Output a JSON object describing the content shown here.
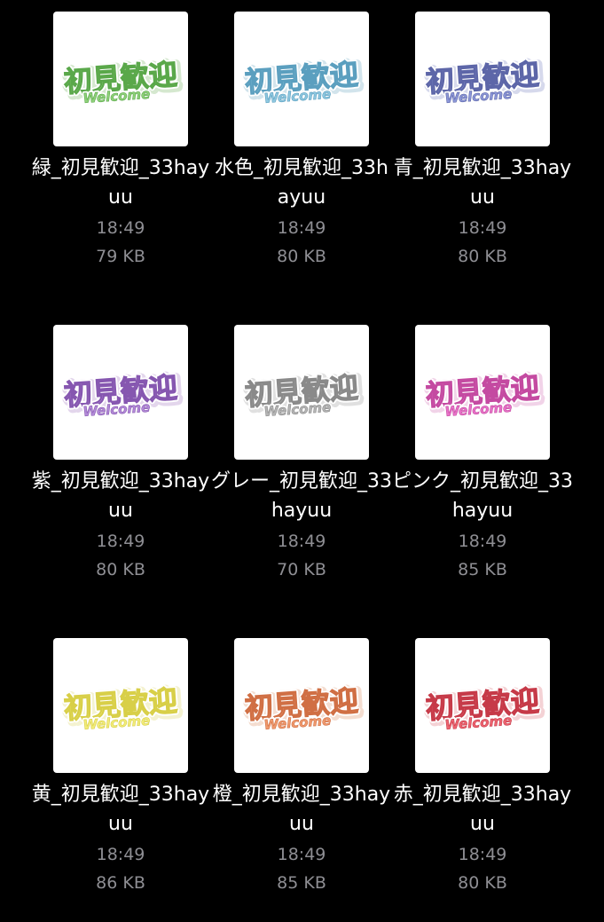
{
  "files": [
    {
      "name": "緑_初見歓迎_33hayuu",
      "time": "18:49",
      "size": "79 KB",
      "logo": {
        "kanji": "初見歓迎",
        "sub": "Welcome",
        "fill": "#8fd17a",
        "stroke": "#5aa84a",
        "shadow": "#d5e8cf"
      }
    },
    {
      "name": "水色_初見歓迎_33hayuu",
      "time": "18:49",
      "size": "80 KB",
      "logo": {
        "kanji": "初見歓迎",
        "sub": "Welcome",
        "fill": "#8fc8e0",
        "stroke": "#5b9fbf",
        "shadow": "#d2e4ec"
      }
    },
    {
      "name": "青_初見歓迎_33hayuu",
      "time": "18:49",
      "size": "80 KB",
      "logo": {
        "kanji": "初見歓迎",
        "sub": "Welcome",
        "fill": "#8c97d8",
        "stroke": "#5d66a8",
        "shadow": "#d6d9ec"
      }
    },
    {
      "name": "紫_初見歓迎_33hayuu",
      "time": "18:49",
      "size": "80 KB",
      "logo": {
        "kanji": "初見歓迎",
        "sub": "Welcome",
        "fill": "#b38ad8",
        "stroke": "#8657b0",
        "shadow": "#e3d6ec"
      }
    },
    {
      "name": "グレー_初見歓迎_33hayuu",
      "time": "18:49",
      "size": "70 KB",
      "logo": {
        "kanji": "初見歓迎",
        "sub": "Welcome",
        "fill": "#b5b5b5",
        "stroke": "#8a8a8a",
        "shadow": "#e0e0e0"
      }
    },
    {
      "name": "ピンク_初見歓迎_33hayuu",
      "time": "18:49",
      "size": "85 KB",
      "logo": {
        "kanji": "初見歓迎",
        "sub": "Welcome",
        "fill": "#e872c8",
        "stroke": "#c44aa1",
        "shadow": "#f1d3e8"
      }
    },
    {
      "name": "黄_初見歓迎_33hayuu",
      "time": "18:49",
      "size": "86 KB",
      "logo": {
        "kanji": "初見歓迎",
        "sub": "Welcome",
        "fill": "#f2ec7a",
        "stroke": "#d8cf48",
        "shadow": "#f4f2d0"
      }
    },
    {
      "name": "橙_初見歓迎_33hayuu",
      "time": "18:49",
      "size": "85 KB",
      "logo": {
        "kanji": "初見歓迎",
        "sub": "Welcome",
        "fill": "#f09a6e",
        "stroke": "#d06f44",
        "shadow": "#f4ddd0"
      }
    },
    {
      "name": "赤_初見歓迎_33hayuu",
      "time": "18:49",
      "size": "80 KB",
      "logo": {
        "kanji": "初見歓迎",
        "sub": "Welcome",
        "fill": "#ee6470",
        "stroke": "#c63a48",
        "shadow": "#f4d2d5"
      }
    }
  ]
}
